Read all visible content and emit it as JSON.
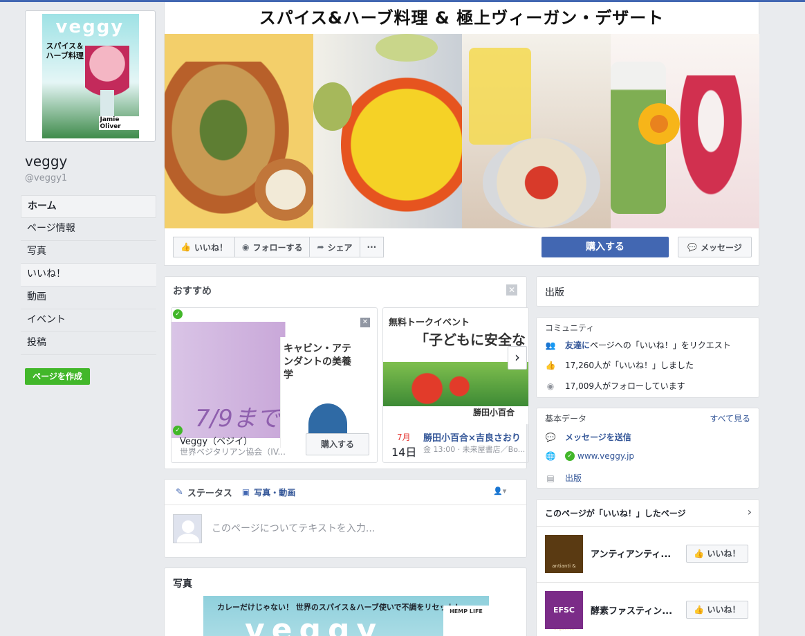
{
  "page": {
    "name": "veggy",
    "handle": "@veggy1",
    "profile_cover": {
      "logo": "veggy",
      "headline": "スパイス＆ハーブ料理",
      "person": "Jamie Oliver"
    },
    "create_page_label": "ページを作成"
  },
  "nav": {
    "items": [
      {
        "label": "ホーム",
        "selected": true
      },
      {
        "label": "ページ情報"
      },
      {
        "label": "写真"
      },
      {
        "label": "いいね！"
      },
      {
        "label": "動画"
      },
      {
        "label": "イベント"
      },
      {
        "label": "投稿"
      }
    ]
  },
  "cover": {
    "title": "スパイス&ハーブ料理 & 極上ヴィーガン・デザート",
    "actions": {
      "like": "いいね！",
      "follow": "フォローする",
      "share": "シェア",
      "more": "···"
    },
    "buy": "購入する",
    "message": "メッセージ"
  },
  "recommended": {
    "title": "おすすめ",
    "card1": {
      "book_title": "キャビン・アテンダントの美養学",
      "big_text": "7/9まで",
      "name": "Veggy（ベジイ）",
      "subtitle": "世界ベジタリアン協会（IV...",
      "button": "購入する"
    },
    "card2": {
      "image_heading": "無料トークイベント",
      "image_subheading": "「子どもに安全な",
      "author": "勝田小百合",
      "month": "7月",
      "day": "14日",
      "event_title": "勝田小百合×吉良さおり",
      "event_detail": "金 13:00 · 未来屋書店／Bo..."
    }
  },
  "composer": {
    "status_tab": "ステータス",
    "photo_tab": "写真・動画",
    "placeholder": "このページについてテキストを入力..."
  },
  "photos": {
    "title": "写真",
    "image_text": "カレーだけじゃない！ 世界のスパイス＆ハーブ使いで不調をリセット！",
    "image_logo": "veggy",
    "image_badge": "HEMP LIFE"
  },
  "sidebar": {
    "category": "出版",
    "community": {
      "title": "コミュニティ",
      "invite_link": "友達に",
      "invite_text": "ページへの「いいね！」をリクエスト",
      "likes": "17,260人が「いいね！」しました",
      "follows": "17,009人がフォローしています"
    },
    "about": {
      "title": "基本データ",
      "see_all": "すべて見る",
      "send_message": "メッセージを送信",
      "website": "www.veggy.jp",
      "category": "出版"
    },
    "liked_pages": {
      "title": "このページが「いいね！」したページ",
      "items": [
        {
          "name": "アンティアンティ...",
          "logo_text": "antianti & organics",
          "button": "いいね！"
        },
        {
          "name": "酵素ファスティン...",
          "logo_text": "EFSC",
          "button": "いいね！"
        }
      ]
    }
  }
}
